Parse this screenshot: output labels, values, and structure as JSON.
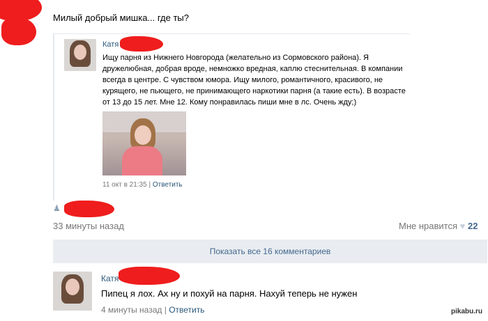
{
  "post": {
    "title": "Милый добрый мишка... где ты?"
  },
  "quoted": {
    "author": "Катя",
    "text": "Ищу парня из Нижнего Новгорода (желательно из Сормовского района). Я дружелюбная, добрая вроде, немножко вредная, каплю стеснительная. В компании всегда в центре. С чувством юмора. Ищу милого, романтичного, красивого, не курящего, не пьющего, не принимающего наркотики парня (а такие есть). В возрасте от 13 до 15 лет. Мне 12. Кому понравилась пиши мне в лс. Очень жду;)",
    "time": "11 окт в 21:35",
    "separator": "|",
    "reply": "Ответить"
  },
  "repost_meta": {
    "time": "33 минуты назад",
    "like_label": "Мне нравится",
    "like_icon": "heart-icon",
    "like_count": "22"
  },
  "show_all": {
    "label": "Показать все 16 комментариев"
  },
  "comment": {
    "author": "Катя",
    "text": "Пипец я лох. Ах ну и похуй на парня. Нахуй теперь не нужен",
    "time": "4 минуты назад",
    "separator": "|",
    "reply": "Ответить"
  },
  "watermark": {
    "text": "pikabu.ru"
  },
  "colors": {
    "link": "#2b587a",
    "accent": "#45688e",
    "censor_red": "#ef1d1d",
    "bar_bg": "#e9edf1"
  }
}
